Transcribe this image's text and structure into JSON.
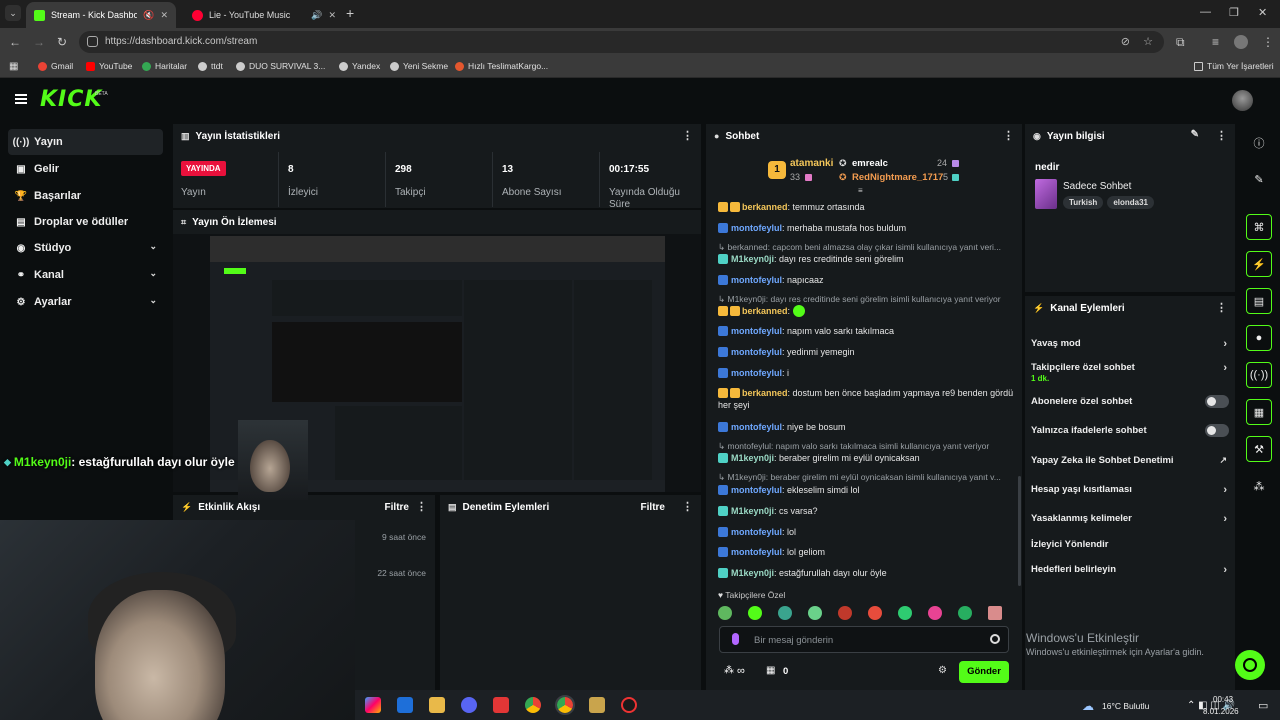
{
  "browser": {
    "tabs": [
      {
        "title": "Stream - Kick Dashboard",
        "active": true
      },
      {
        "title": "Lie - YouTube Music",
        "active": false
      }
    ],
    "url": "https://dashboard.kick.com/stream",
    "bookmarks": [
      "Gmail",
      "YouTube",
      "Haritalar",
      "ttdt",
      "DUO SURVIVAL 3...",
      "Yandex",
      "Yeni Sekme",
      "Hızlı TeslimatKargo...",
      "Tüm Yer İşaretleri"
    ]
  },
  "kick": {
    "logo": "KICK",
    "beta": "BETA"
  },
  "sidebar": {
    "items": [
      {
        "label": "Yayın",
        "icon": "broadcast-icon"
      },
      {
        "label": "Gelir",
        "icon": "dollar-icon"
      },
      {
        "label": "Başarılar",
        "icon": "trophy-icon"
      },
      {
        "label": "Droplar ve ödüller",
        "icon": "gift-icon"
      },
      {
        "label": "Stüdyo",
        "icon": "studio-icon"
      },
      {
        "label": "Kanal",
        "icon": "channel-icon"
      },
      {
        "label": "Ayarlar",
        "icon": "gear-icon"
      }
    ]
  },
  "stats": {
    "title": "Yayın İstatistikleri",
    "live_badge": "YAYINDA",
    "items": [
      {
        "value": "",
        "label": "Yayın"
      },
      {
        "value": "8",
        "label": "İzleyici"
      },
      {
        "value": "298",
        "label": "Takipçi"
      },
      {
        "value": "13",
        "label": "Abone Sayısı"
      },
      {
        "value": "00:17:55",
        "label": "Yayında Olduğu Süre"
      }
    ]
  },
  "preview": {
    "title": "Yayın Ön İzlemesi"
  },
  "overlay_chat": {
    "user": "M1keyn0ji",
    "text": ": estağfurullah dayı olur öyle"
  },
  "activity": {
    "title": "Etkinlik Akışı",
    "filter": "Filtre",
    "times": [
      "9 saat önce",
      "22 saat önce"
    ]
  },
  "moderation": {
    "title": "Denetim Eylemleri",
    "filter": "Filtre"
  },
  "chat": {
    "title": "Sohbet",
    "leaderboard": {
      "rank": "1",
      "first": {
        "name": "atamanki",
        "count": "33"
      },
      "second": {
        "name": "emrealc",
        "count": "24"
      },
      "third": {
        "name": "RedNightmare_1717",
        "count": "5"
      }
    },
    "messages": [
      {
        "user": "berkanned",
        "text": ": temmuz ortasında"
      },
      {
        "user": "montofeylul",
        "text": ": merhaba mustafa hos buldum"
      },
      {
        "reply": "berkanned: capcom beni almazsa olay çıkar isimli kullanıcıya yanıt veri..."
      },
      {
        "user": "M1keyn0ji",
        "text": ": dayı res creditinde seni görelim"
      },
      {
        "user": "montofeylul",
        "text": ": napıcaaz"
      },
      {
        "reply": "M1keyn0ji: dayı res creditinde seni görelim isimli kullanıcıya yanıt veriyor"
      },
      {
        "user": "berkanned",
        "text": ":"
      },
      {
        "user": "montofeylul",
        "text": ": napım valo sarkı takılmaca"
      },
      {
        "user": "montofeylul",
        "text": ": yedinmi yemegin"
      },
      {
        "user": "montofeylul",
        "text": ": i"
      },
      {
        "user": "berkanned",
        "text": ": dostum ben önce başladım yapmaya re9 benden gördü her şeyi"
      },
      {
        "user": "montofeylul",
        "text": ": niye be bosum"
      },
      {
        "reply": "montofeylul: napım valo sarkı takılmaca isimli kullanıcıya yanıt veriyor"
      },
      {
        "user": "M1keyn0ji",
        "text": ": beraber girelim mi eylül oynicaksan"
      },
      {
        "reply": "M1keyn0ji: beraber girelim mi eylül oynicaksan isimli kullanıcıya yanıt v..."
      },
      {
        "user": "montofeylul",
        "text": ": ekleselim simdi lol"
      },
      {
        "user": "M1keyn0ji",
        "text": ": cs varsa?"
      },
      {
        "user": "montofeylul",
        "text": ": lol"
      },
      {
        "user": "montofeylul",
        "text": ": lol geliom"
      },
      {
        "user": "M1keyn0ji",
        "text": ": estağfurullah dayı olur öyle"
      }
    ],
    "followers_only": "Takipçilere Özel",
    "input_placeholder": "Bir mesaj gönderin",
    "points": "∞",
    "gifts": "0",
    "send": "Gönder"
  },
  "stream_info": {
    "title": "Yayın bilgisi",
    "stream_title": "nedir",
    "category": "Sadece Sohbet",
    "tags": [
      "Turkish",
      "elonda31"
    ]
  },
  "channel_actions": {
    "title": "Kanal Eylemleri",
    "items": [
      {
        "label": "Yavaş mod"
      },
      {
        "label": "Takipçilere özel sohbet",
        "sub": "1 dk."
      },
      {
        "label": "Abonelere özel sohbet"
      },
      {
        "label": "Yalnızca ifadelerle sohbet"
      },
      {
        "label": "Yapay Zeka ile Sohbet Denetimi"
      },
      {
        "label": "Hesap yaşı kısıtlaması"
      },
      {
        "label": "Yasaklanmış kelimeler"
      },
      {
        "label": "İzleyici Yönlendir"
      },
      {
        "label": "Hedefleri belirleyin"
      }
    ]
  },
  "windows": {
    "activate_title": "Windows'u Etkinleştir",
    "activate_sub": "Windows'u etkinleştirmek için Ayarlar'a gidin.",
    "weather": "16°C  Bulutlu",
    "time": "00:43",
    "date": "8.01.2026"
  }
}
